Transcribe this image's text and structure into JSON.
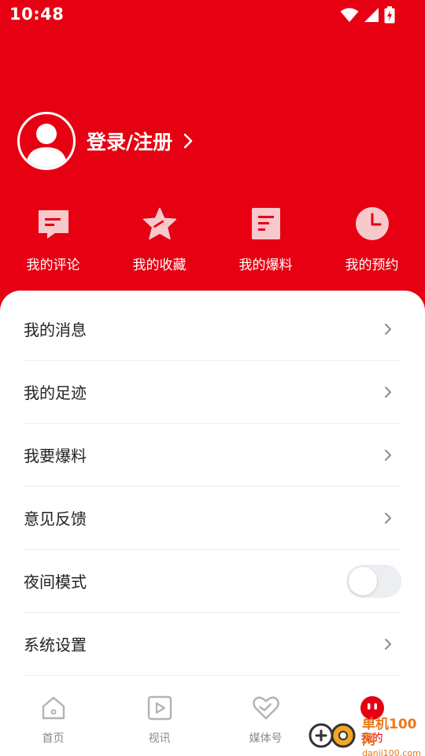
{
  "status_bar": {
    "time": "10:48",
    "icons": [
      "wifi-icon",
      "signal-icon",
      "battery-charging-icon"
    ]
  },
  "profile": {
    "login_label": "登录/注册",
    "avatar_icon": "user-avatar-icon",
    "chevron_icon": "chevron-right-icon"
  },
  "quick_actions": [
    {
      "label": "我的评论",
      "icon": "comment-icon"
    },
    {
      "label": "我的收藏",
      "icon": "star-icon"
    },
    {
      "label": "我的爆料",
      "icon": "document-icon"
    },
    {
      "label": "我的预约",
      "icon": "clock-icon"
    }
  ],
  "menu": {
    "items": [
      {
        "label": "我的消息",
        "control": "chevron"
      },
      {
        "label": "我的足迹",
        "control": "chevron"
      },
      {
        "label": "我要爆料",
        "control": "chevron"
      },
      {
        "label": "意见反馈",
        "control": "chevron"
      },
      {
        "label": "夜间模式",
        "control": "toggle",
        "toggle_on": false
      },
      {
        "label": "系统设置",
        "control": "chevron"
      }
    ]
  },
  "bottom_nav": {
    "items": [
      {
        "label": "首页",
        "icon": "home-icon",
        "active": false
      },
      {
        "label": "视讯",
        "icon": "video-play-icon",
        "active": false
      },
      {
        "label": "媒体号",
        "icon": "heart-icon",
        "active": false
      },
      {
        "label": "我的",
        "icon": "profile-face-icon",
        "active": true
      }
    ]
  },
  "watermark": {
    "title": "单机100网",
    "url": "danji100.com"
  },
  "colors": {
    "primary": "#e60012",
    "text": "#222222",
    "nav_inactive": "#8a8a8a",
    "divider": "#ececec",
    "watermark": "#e8791b"
  }
}
